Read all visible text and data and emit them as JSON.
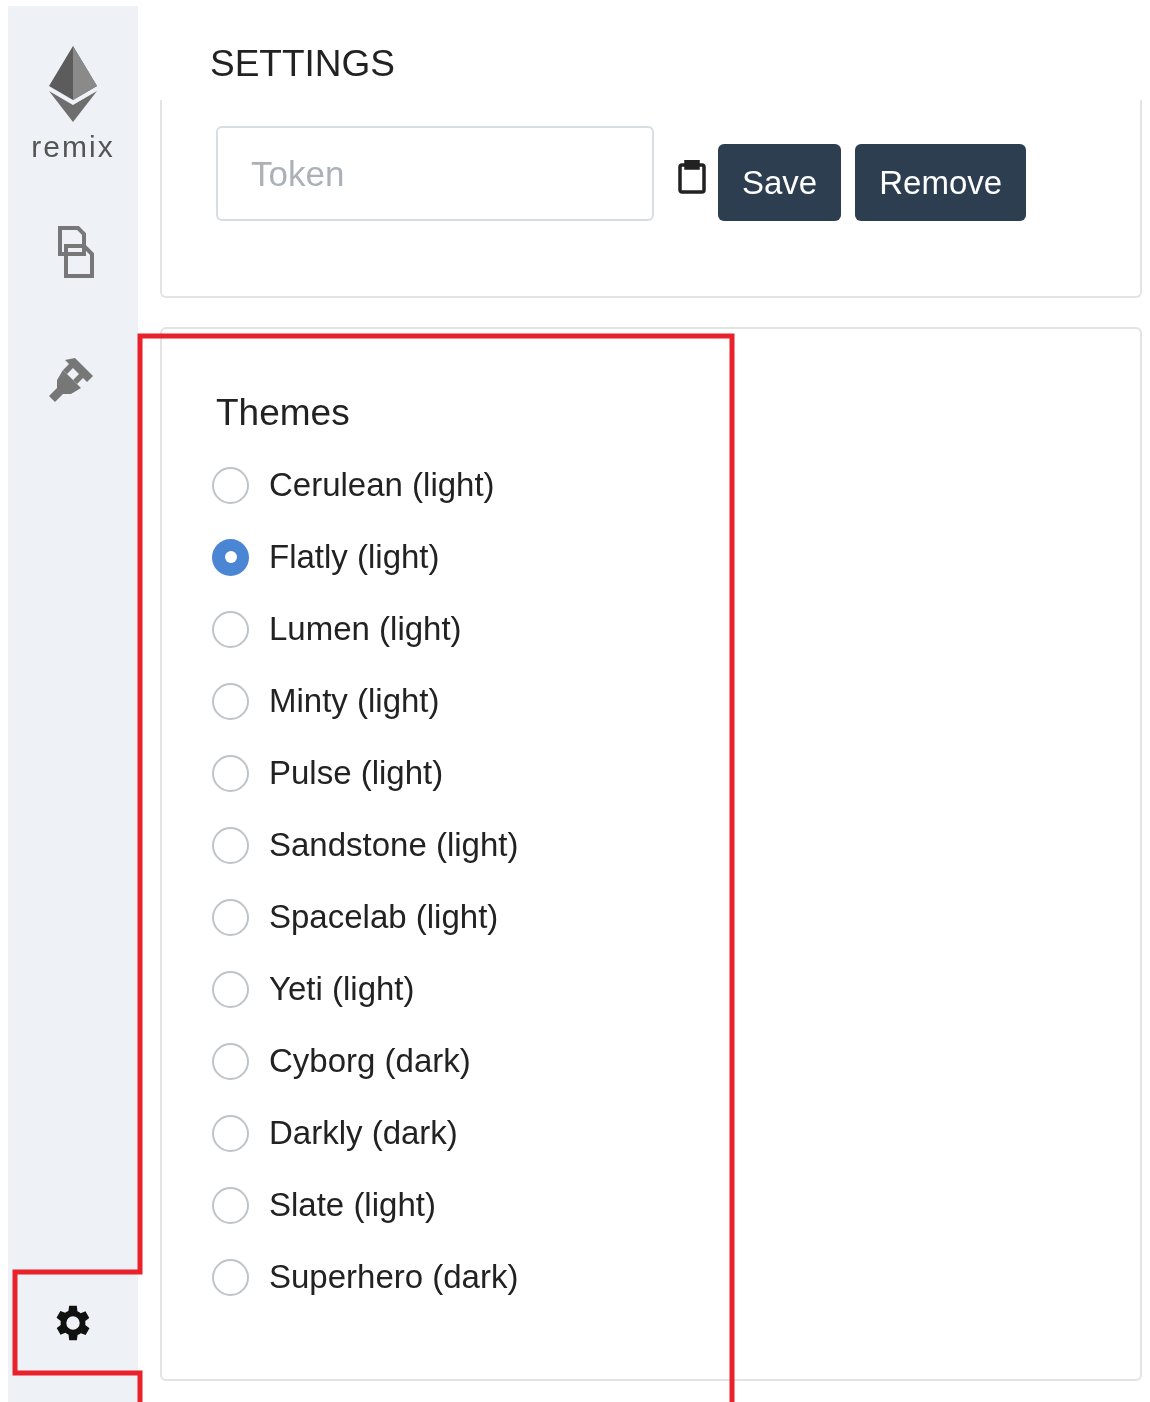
{
  "sidebar": {
    "logo_text": "remix"
  },
  "title": "SETTINGS",
  "token": {
    "placeholder": "Token"
  },
  "buttons": [
    "Save",
    "Remove"
  ],
  "themes": {
    "heading": "Themes",
    "options": [
      {
        "label": "Cerulean (light)",
        "selected": false
      },
      {
        "label": "Flatly (light)",
        "selected": true
      },
      {
        "label": "Lumen (light)",
        "selected": false
      },
      {
        "label": "Minty (light)",
        "selected": false
      },
      {
        "label": "Pulse (light)",
        "selected": false
      },
      {
        "label": "Sandstone (light)",
        "selected": false
      },
      {
        "label": "Spacelab (light)",
        "selected": false
      },
      {
        "label": "Yeti (light)",
        "selected": false
      },
      {
        "label": "Cyborg (dark)",
        "selected": false
      },
      {
        "label": "Darkly (dark)",
        "selected": false
      },
      {
        "label": "Slate (light)",
        "selected": false
      },
      {
        "label": "Superhero (dark)",
        "selected": false
      }
    ]
  }
}
